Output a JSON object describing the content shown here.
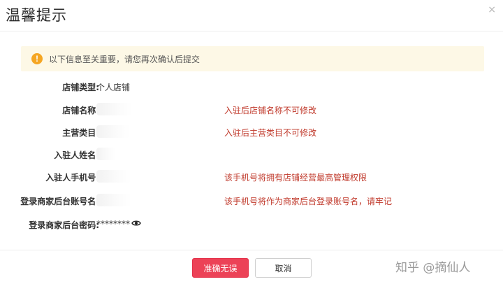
{
  "dialog": {
    "title": "温馨提示",
    "close_glyph": "×"
  },
  "notice": {
    "icon": "warning-icon",
    "icon_glyph": "!",
    "text": "以下信息至关重要，请您再次确认后提交"
  },
  "fields": [
    {
      "label": "店铺类型:",
      "value": "个人店铺",
      "hint": ""
    },
    {
      "label": "店铺名称:",
      "value": "",
      "hint": "入驻后店铺名称不可修改"
    },
    {
      "label": "主营类目:",
      "value": "",
      "hint": "入驻后主营类目不可修改"
    },
    {
      "label": "入驻人姓名:",
      "value": "",
      "hint": ""
    },
    {
      "label": "入驻人手机号:",
      "value": "",
      "hint": "该手机号将拥有店铺经营最高管理权限"
    },
    {
      "label": "登录商家后台账号名:",
      "value": "",
      "hint": "该手机号将作为商家后台登录账号名，请牢记"
    },
    {
      "label": "登录商家后台密码:",
      "value": "********",
      "hint": ""
    }
  ],
  "buttons": {
    "confirm": "准确无误",
    "cancel": "取消"
  },
  "watermark": "知乎 @摘仙人",
  "colors": {
    "accent": "#ec4257",
    "hint": "#c0392b",
    "notice_bg": "#fdf8e6",
    "notice_icon": "#f5a623"
  }
}
